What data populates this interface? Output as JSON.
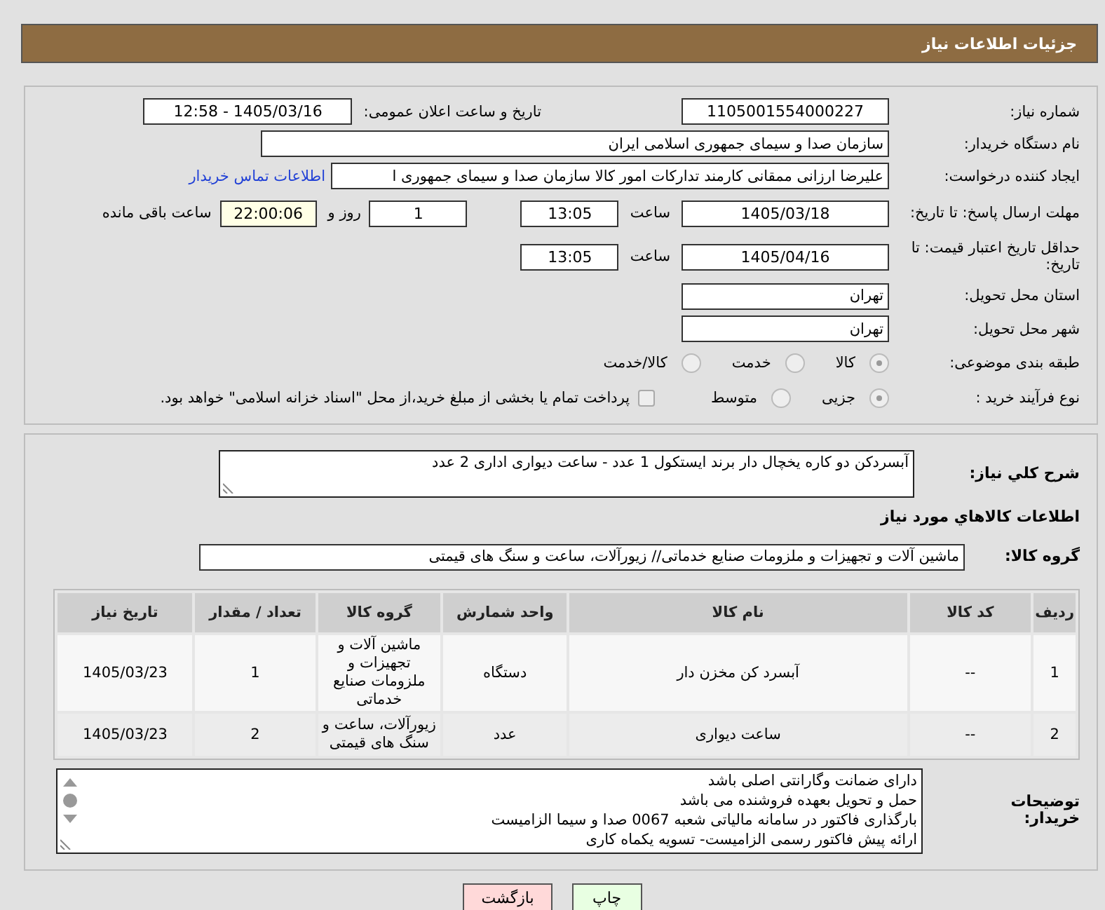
{
  "header": {
    "title": "جزئیات اطلاعات نیاز"
  },
  "need_number": {
    "label": "شماره نیاز:",
    "value": "1105001554000227"
  },
  "announce": {
    "label": "تاریخ و ساعت اعلان عمومی:",
    "value": "1405/03/16 - 12:58"
  },
  "buyer_org": {
    "label": "نام دستگاه خریدار:",
    "value": "سازمان صدا و سیمای جمهوری اسلامی ایران"
  },
  "requester": {
    "label": "ایجاد کننده درخواست:",
    "value": "علیرضا ارزانی ممقانی کارمند تدارکات امور کالا سازمان صدا و سیمای جمهوری ا",
    "link": "اطلاعات تماس خریدار"
  },
  "response_deadline": {
    "label": "مهلت ارسال پاسخ: تا تاریخ:",
    "date": "1405/03/18",
    "time_label": "ساعت",
    "time": "13:05",
    "days": "1",
    "days_label": "روز و",
    "remaining": "22:00:06",
    "remaining_label": "ساعت باقی مانده"
  },
  "price_validity": {
    "label": "حداقل تاریخ اعتبار قیمت: تا تاریخ:",
    "date": "1405/04/16",
    "time_label": "ساعت",
    "time": "13:05"
  },
  "province": {
    "label": "استان محل تحویل:",
    "value": "تهران"
  },
  "city": {
    "label": "شهر محل تحویل:",
    "value": "تهران"
  },
  "category": {
    "label": "طبقه بندی موضوعی:",
    "options": [
      {
        "label": "کالا",
        "selected": true
      },
      {
        "label": "خدمت",
        "selected": false
      },
      {
        "label": "کالا/خدمت",
        "selected": false
      }
    ]
  },
  "process": {
    "label": "نوع فرآیند خرید :",
    "options": [
      {
        "label": "جزیی",
        "selected": true
      },
      {
        "label": "متوسط",
        "selected": false
      }
    ],
    "payment_note": {
      "checked": false,
      "text": "پرداخت تمام یا بخشی از مبلغ خرید،از محل \"اسناد خزانه اسلامی\" خواهد بود."
    }
  },
  "description": {
    "label": "شرح کلي نیاز:",
    "value": "آبسردکن دو کاره یخچال دار برند ایستکول 1 عدد - ساعت دیواری اداری 2 عدد"
  },
  "goods_title": "اطلاعات کالاهاي مورد نیاز",
  "goods_group": {
    "label": "گروه کالا:",
    "value": "ماشین آلات و تجهیزات و ملزومات صنایع خدماتی// زیورآلات، ساعت و سنگ های قیمتی"
  },
  "table": {
    "columns": [
      "ردیف",
      "کد کالا",
      "نام کالا",
      "واحد شمارش",
      "گروه کالا",
      "تعداد / مقدار",
      "تاریخ نیاز"
    ],
    "rows": [
      [
        "1",
        "--",
        "آبسرد کن مخزن دار",
        "دستگاه",
        "ماشین آلات و تجهیزات و ملزومات صنایع خدماتی",
        "1",
        "1405/03/23"
      ],
      [
        "2",
        "--",
        "ساعت دیواری",
        "عدد",
        "زیورآلات، ساعت و سنگ های قیمتی",
        "2",
        "1405/03/23"
      ]
    ]
  },
  "buyer_notes": {
    "label": "توضیحات خریدار:",
    "lines": [
      "دارای ضمانت وگارانتی اصلی باشد",
      "حمل و تحویل بعهده فروشنده می باشد",
      "بارگذاری فاکتور در سامانه مالیاتی شعبه 0067 صدا و سیما الزامیست",
      "ارائه پیش فاکتور رسمی الزامیست- تسویه یکماه کاری"
    ]
  },
  "buttons": [
    {
      "label": "چاپ",
      "kind": "print"
    },
    {
      "label": "بازگشت",
      "kind": "back"
    }
  ]
}
